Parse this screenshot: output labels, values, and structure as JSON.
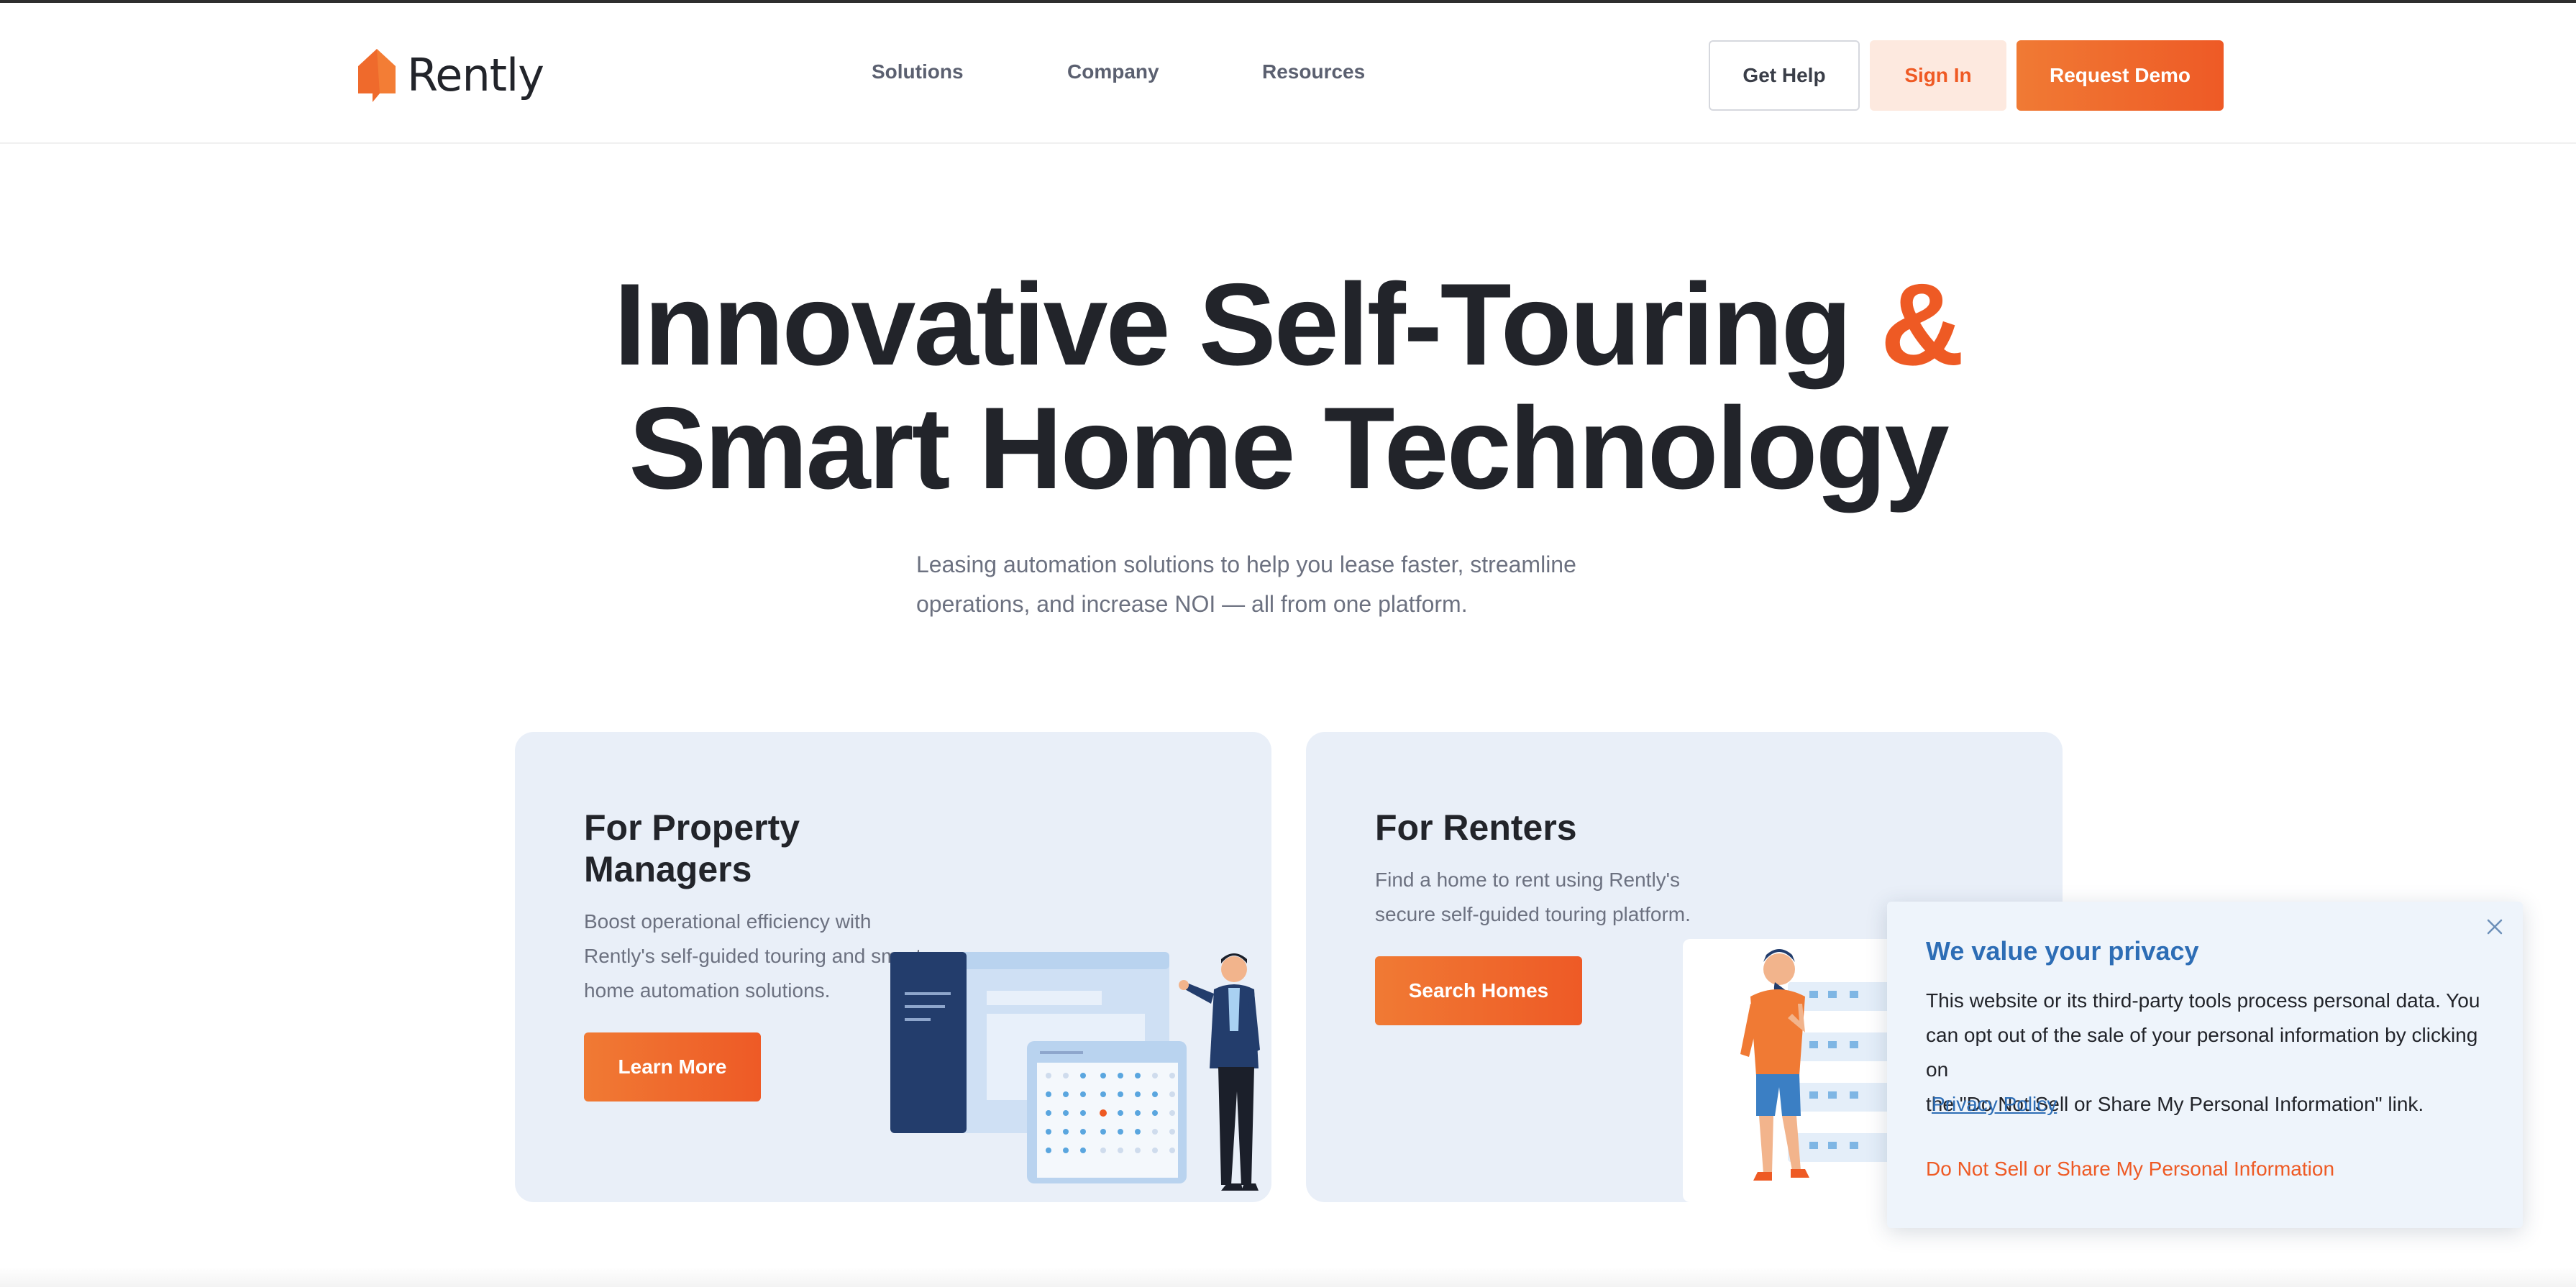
{
  "header": {
    "logo_text": "Rently",
    "nav": [
      "Solutions",
      "Company",
      "Resources"
    ],
    "get_help": "Get Help",
    "sign_in": "Sign In",
    "request_demo": "Request Demo"
  },
  "hero": {
    "title_line1": "Innovative Self-Touring",
    "title_amp": "&",
    "title_line2": "Smart Home Technology",
    "subtitle_line1": "Leasing automation solutions to help you lease faster, streamline",
    "subtitle_line2": "operations, and increase NOI — all from one platform."
  },
  "cards": {
    "property_managers": {
      "title_line1": "For Property",
      "title_line2": "Managers",
      "desc_line1": "Boost operational efficiency with",
      "desc_line2": "Rently's self-guided touring and smart",
      "desc_line3": "home automation solutions.",
      "button": "Learn More"
    },
    "renters": {
      "title": "For Renters",
      "desc_line1": "Find a home to rent using Rently's",
      "desc_line2": "secure self-guided touring platform.",
      "button": "Search Homes"
    }
  },
  "privacy": {
    "title": "We value your privacy",
    "body_line1": "This website or its third-party tools process personal data. You",
    "body_line2": "can opt out of the sale of your personal information by clicking on",
    "body_line3": "the \"Do Not Sell or Share My Personal Information\" link.",
    "policy_link": "Privacy Policy",
    "dns_link": "Do Not Sell or Share My Personal Information",
    "close_icon": "close-icon"
  },
  "colors": {
    "brand_orange": "#ee5a24",
    "privacy_blue": "#2d6db5",
    "card_bg": "#e9eff8",
    "text_dark": "#22242a"
  }
}
